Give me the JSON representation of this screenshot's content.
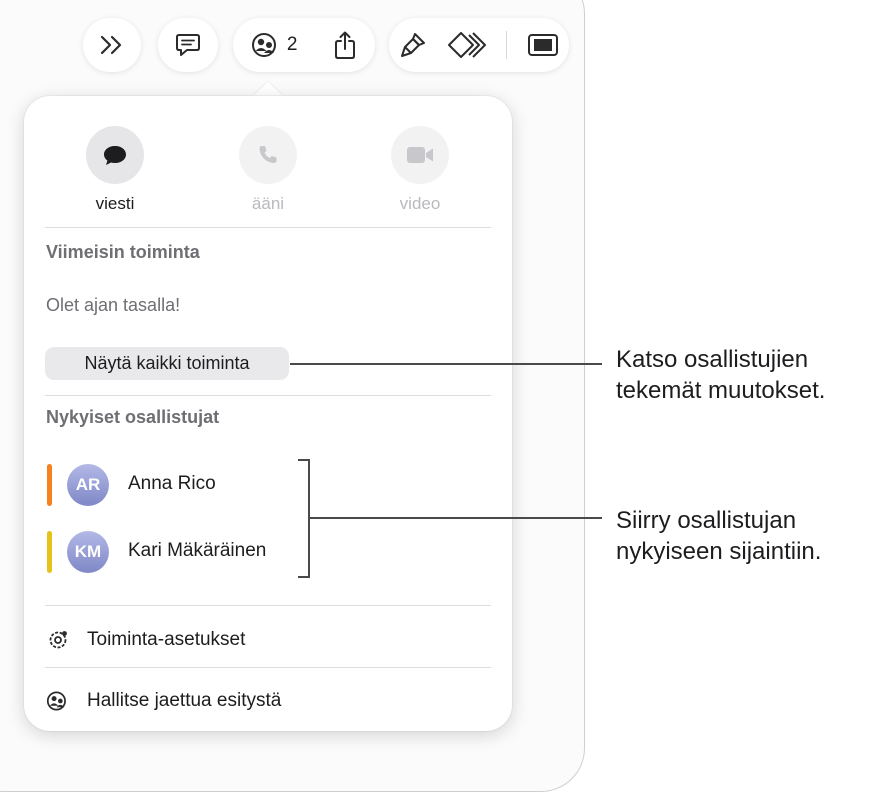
{
  "toolbar": {
    "collaborators_count": "2",
    "icons": [
      "chevrons-right-icon",
      "comment-icon",
      "collaboration-icon",
      "share-icon",
      "format-brush-icon",
      "animate-icon",
      "document-icon"
    ]
  },
  "popover": {
    "comm": [
      {
        "label": "viesti",
        "icon": "message-icon",
        "enabled": true
      },
      {
        "label": "ääni",
        "icon": "phone-icon",
        "enabled": false
      },
      {
        "label": "video",
        "icon": "video-icon",
        "enabled": false
      }
    ],
    "recent_activity": {
      "title": "Viimeisin toiminta",
      "status": "Olet ajan tasalla!",
      "show_all_button": "Näytä kaikki toiminta"
    },
    "participants": {
      "title": "Nykyiset osallistujat",
      "items": [
        {
          "initials": "AR",
          "name": "Anna Rico",
          "color": "#f5821f"
        },
        {
          "initials": "KM",
          "name": "Kari Mäkäräinen",
          "color": "#e6c21a"
        }
      ]
    },
    "menu": [
      {
        "label": "Toiminta-asetukset",
        "icon": "activity-settings-icon"
      },
      {
        "label": "Hallitse jaettua esitystä",
        "icon": "manage-shared-icon"
      }
    ]
  },
  "callouts": {
    "changes": [
      "Katso osallistujien",
      "tekemät muutokset."
    ],
    "location": [
      "Siirry osallistujan",
      "nykyiseen sijaintiin."
    ]
  }
}
